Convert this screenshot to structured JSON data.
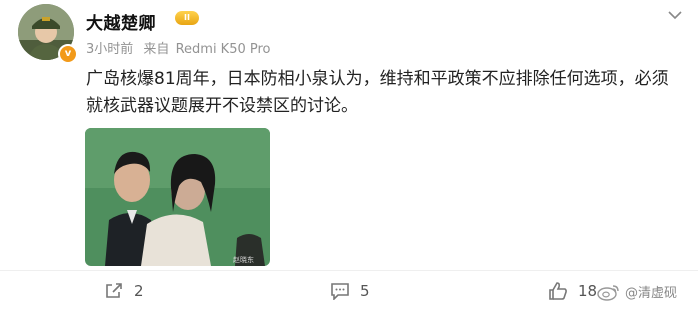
{
  "post": {
    "username": "大越楚卿",
    "level_badge": "II",
    "verify_badge": "v",
    "time": "3小时前",
    "source_prefix": "来自",
    "device": "Redmi K50 Pro",
    "text": "广岛核爆81周年，日本防相小泉认为，维持和平政策不应排除任何选项，必须就核武器议题展开不设禁区的讨论。",
    "image_caption": "赵晓东"
  },
  "actions": {
    "share_count": "2",
    "comment_count": "5",
    "like_count": "18"
  },
  "watermark": {
    "handle": "@清虚砚"
  },
  "colors": {
    "text": "#222222",
    "meta": "#939393",
    "badge": "#f29a1a",
    "vip": "#e8a514"
  },
  "icons": [
    "more-icon",
    "share-icon",
    "comment-icon",
    "like-icon",
    "weibo-logo-icon"
  ]
}
